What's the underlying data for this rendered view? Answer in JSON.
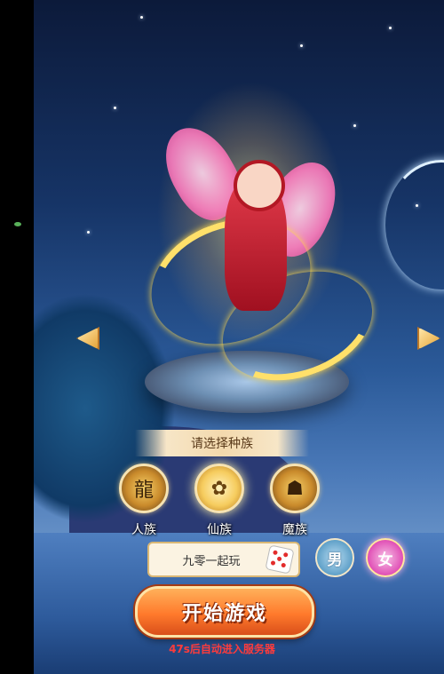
{
  "race_select": {
    "title": "请选择种族",
    "races": [
      {
        "label": "人族",
        "icon": "dragon-emblem-icon",
        "selected": false
      },
      {
        "label": "仙族",
        "icon": "lotus-emblem-icon",
        "selected": true
      },
      {
        "label": "魔族",
        "icon": "demon-emblem-icon",
        "selected": false
      }
    ]
  },
  "name_input": {
    "value": "九零一起玩"
  },
  "gender": {
    "male_label": "男",
    "female_label": "女",
    "selected": "female"
  },
  "start_button": {
    "label": "开始游戏"
  },
  "auto_enter_hint": "47s后自动进入服务器",
  "colors": {
    "accent": "#ff7a2c",
    "hint": "#ff3b3b",
    "panel": "#f7e6c7"
  }
}
